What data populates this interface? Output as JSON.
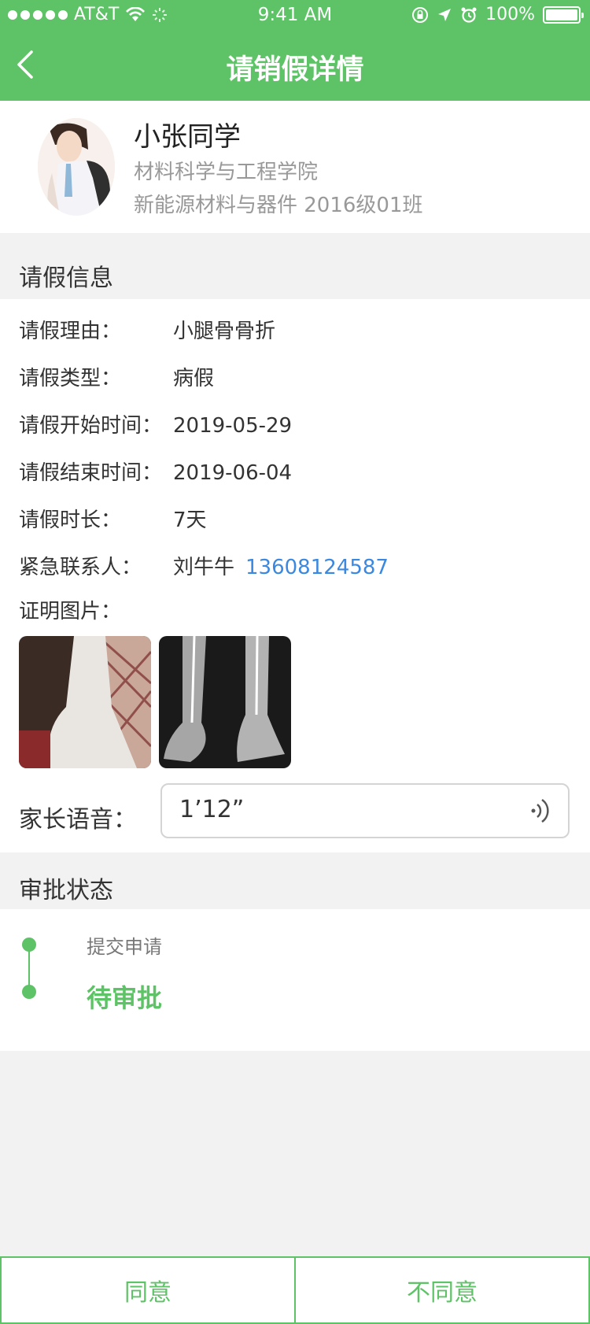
{
  "status_bar": {
    "carrier": "AT&T",
    "time": "9:41 AM",
    "battery": "100%"
  },
  "nav": {
    "title": "请销假详情"
  },
  "profile": {
    "name": "小张同学",
    "college": "材料科学与工程学院",
    "class": "新能源材料与器件 2016级01班"
  },
  "leave_section": {
    "title": "请假信息",
    "reason_label": "请假理由：",
    "reason": "小腿骨骨折",
    "type_label": "请假类型：",
    "type": "病假",
    "start_label": "请假开始时间：",
    "start": "2019-05-29",
    "end_label": "请假结束时间：",
    "end": "2019-06-04",
    "duration_label": "请假时长：",
    "duration": "7天",
    "contact_label": "紧急联系人：",
    "contact_name": "刘牛牛",
    "contact_phone": "13608124587",
    "photos_label": "证明图片：",
    "voice_label": "家长语音：",
    "voice_duration": "1’12”"
  },
  "approval_section": {
    "title": "审批状态",
    "steps": [
      "提交申请",
      "待审批"
    ]
  },
  "actions": {
    "agree": "同意",
    "disagree": "不同意"
  },
  "colors": {
    "brand": "#5ec266",
    "link": "#3a88e0"
  }
}
